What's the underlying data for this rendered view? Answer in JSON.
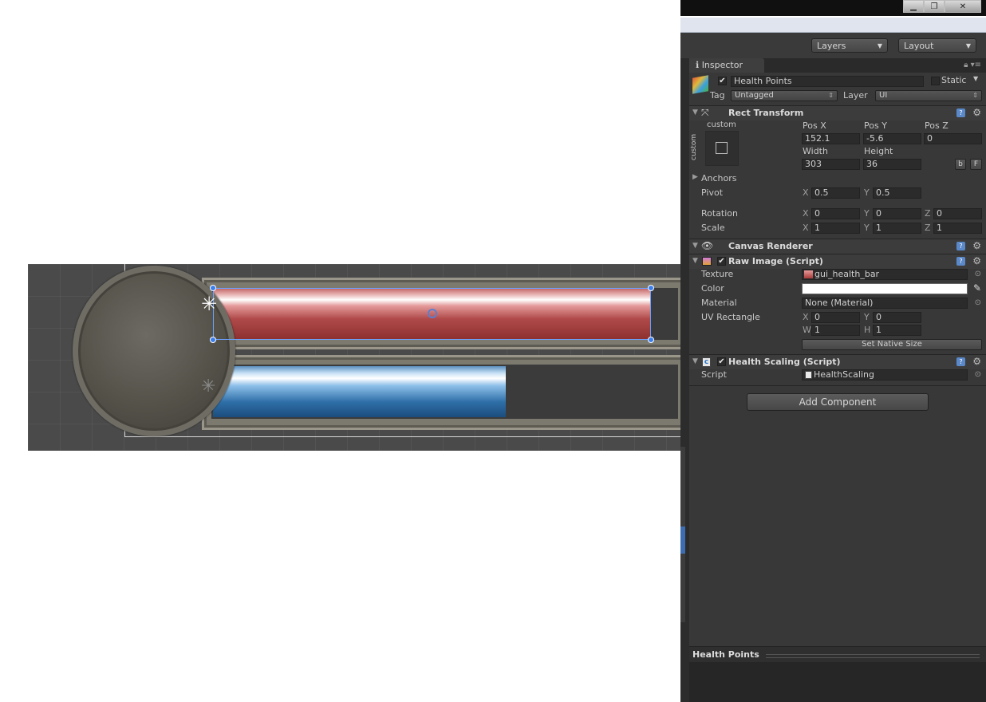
{
  "window": {
    "minimize_icon": "minimize-icon",
    "restore_icon": "restore-icon",
    "close_icon": "close-icon"
  },
  "toolbar": {
    "layers_label": "Layers",
    "layout_label": "Layout"
  },
  "inspector": {
    "tab_label": "Inspector",
    "object": {
      "name": "Health Points",
      "active": true,
      "static_label": "Static",
      "static_checked": false,
      "tag_label": "Tag",
      "tag_value": "Untagged",
      "layer_label": "Layer",
      "layer_value": "UI"
    },
    "rect_transform": {
      "title": "Rect Transform",
      "anchor_preset_label": "custom",
      "anchor_preset_side_label": "custom",
      "pos_x_label": "Pos X",
      "pos_x": "152.1",
      "pos_y_label": "Pos Y",
      "pos_y": "-5.6",
      "pos_z_label": "Pos Z",
      "pos_z": "0",
      "width_label": "Width",
      "width": "303",
      "height_label": "Height",
      "height": "36",
      "blueprint_btn": "b",
      "raw_edit_btn": "F",
      "anchors_label": "Anchors",
      "pivot_label": "Pivot",
      "pivot_x_label": "X",
      "pivot_x": "0.5",
      "pivot_y_label": "Y",
      "pivot_y": "0.5",
      "rotation_label": "Rotation",
      "rot_x_label": "X",
      "rot_x": "0",
      "rot_y_label": "Y",
      "rot_y": "0",
      "rot_z_label": "Z",
      "rot_z": "0",
      "scale_label": "Scale",
      "scale_x_label": "X",
      "scale_x": "1",
      "scale_y_label": "Y",
      "scale_y": "1",
      "scale_z_label": "Z",
      "scale_z": "1"
    },
    "canvas_renderer": {
      "title": "Canvas Renderer"
    },
    "raw_image": {
      "title": "Raw Image (Script)",
      "enabled": true,
      "texture_label": "Texture",
      "texture_value": "gui_health_bar",
      "color_label": "Color",
      "color_value": "#ffffff",
      "material_label": "Material",
      "material_value": "None (Material)",
      "uv_label": "UV Rectangle",
      "uv_x_label": "X",
      "uv_x": "0",
      "uv_y_label": "Y",
      "uv_y": "0",
      "uv_w_label": "W",
      "uv_w": "1",
      "uv_h_label": "H",
      "uv_h": "1",
      "native_size_btn": "Set Native Size"
    },
    "health_scaling": {
      "title": "Health Scaling (Script)",
      "enabled": true,
      "script_label": "Script",
      "script_value": "HealthScaling"
    },
    "add_component": "Add Component",
    "preview_title": "Health Points"
  },
  "scene": {
    "health_fill": 1.0,
    "mana_fill": 0.63,
    "health_color": "#b04a4a",
    "mana_color": "#2f6fa8"
  }
}
